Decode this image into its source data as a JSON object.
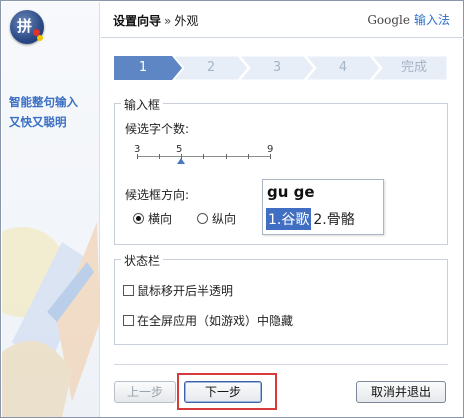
{
  "app": {
    "slogan": [
      "智能整句输入",
      "又快又聪明"
    ]
  },
  "header": {
    "breadcrumb_root": "设置向导",
    "breadcrumb_sep": "»",
    "breadcrumb_current": "外观",
    "brand_google": "Google",
    "brand_ime": "输入法"
  },
  "steps": [
    {
      "label": "1",
      "active": true
    },
    {
      "label": "2",
      "active": false
    },
    {
      "label": "3",
      "active": false
    },
    {
      "label": "4",
      "active": false
    },
    {
      "label": "完成",
      "active": false
    }
  ],
  "candidate_box": {
    "title": "输入框",
    "count_label": "候选字个数:",
    "slider": {
      "labels": [
        "3",
        "5",
        "9"
      ],
      "min": 3,
      "max": 9,
      "value": 5
    },
    "direction_label": "候选框方向:",
    "direction_options": [
      {
        "label": "横向",
        "selected": true
      },
      {
        "label": "纵向",
        "selected": false
      }
    ],
    "preview": {
      "composition": "gu ge",
      "candidates": [
        {
          "text": "1.谷歌",
          "selected": true
        },
        {
          "text": "2.骨骼",
          "selected": false
        }
      ]
    }
  },
  "status_bar": {
    "title": "状态栏",
    "options": [
      {
        "label": "鼠标移开后半透明",
        "checked": false
      },
      {
        "label": "在全屏应用（如游戏）中隐藏",
        "checked": false
      }
    ]
  },
  "buttons": {
    "prev": "上一步",
    "next": "下一步",
    "cancel_exit": "取消并退出"
  },
  "colors": {
    "accent": "#3f6ec2",
    "highlight": "#d63a3a",
    "slogan": "#3a6fc4"
  }
}
